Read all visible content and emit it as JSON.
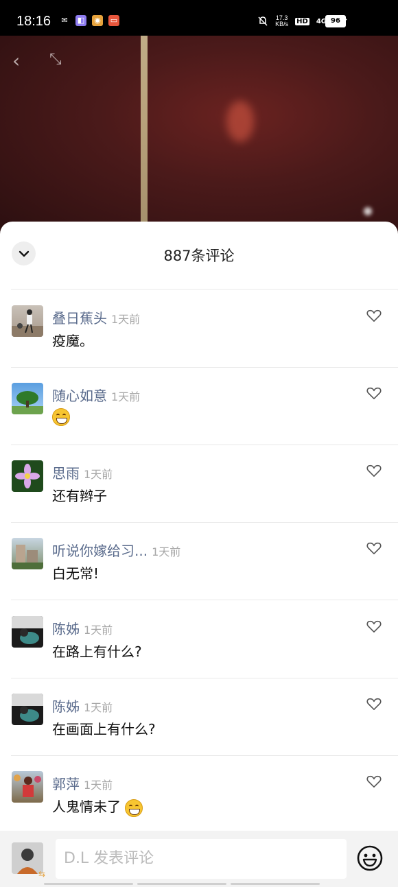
{
  "status_bar": {
    "time": "18:16",
    "net_speed": "17.3",
    "net_unit": "KB/s",
    "hd": "HD",
    "signal": "4G",
    "battery": "96"
  },
  "sheet": {
    "title": "887条评论"
  },
  "comments": [
    {
      "name": "叠日蕉头",
      "time": "1天前",
      "text": "疫魔。"
    },
    {
      "name": "随心如意",
      "time": "1天前",
      "text": ""
    },
    {
      "name": "思雨",
      "time": "1天前",
      "text": "还有辫子"
    },
    {
      "name": "听说你嫁给习...",
      "time": "1天前",
      "text": "白无常!"
    },
    {
      "name": "陈姊",
      "time": "1天前",
      "text": "在路上有什么?"
    },
    {
      "name": "陈姊",
      "time": "1天前",
      "text": "在画面上有什么?"
    },
    {
      "name": "郭萍",
      "time": "1天前",
      "text": "人鬼情未了"
    }
  ],
  "composer": {
    "placeholder": "D.L  发表评论"
  },
  "colors": {
    "name": "#5a6b8c",
    "time": "#a8a8a8",
    "accent": "#e6a23c"
  }
}
